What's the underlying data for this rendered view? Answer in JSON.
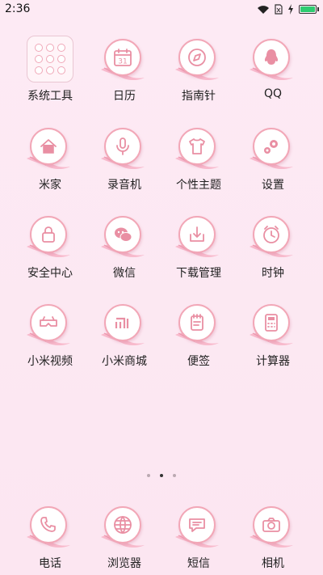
{
  "status_bar": {
    "time": "2:36",
    "battery_level": 1.0,
    "battery_color": "#2ecc71",
    "icons": [
      "wifi-icon",
      "sim-icon",
      "charging-icon",
      "battery-icon"
    ]
  },
  "apps": [
    {
      "label": "系统工具",
      "icon": "folder-icon"
    },
    {
      "label": "日历",
      "icon": "calendar-icon",
      "glyph_text": "31"
    },
    {
      "label": "指南针",
      "icon": "compass-icon"
    },
    {
      "label": "QQ",
      "icon": "qq-penguin-icon"
    },
    {
      "label": "米家",
      "icon": "home-icon"
    },
    {
      "label": "录音机",
      "icon": "microphone-icon"
    },
    {
      "label": "个性主题",
      "icon": "tshirt-icon"
    },
    {
      "label": "设置",
      "icon": "gear-icon"
    },
    {
      "label": "安全中心",
      "icon": "lock-icon"
    },
    {
      "label": "微信",
      "icon": "wechat-icon"
    },
    {
      "label": "下载管理",
      "icon": "download-icon"
    },
    {
      "label": "时钟",
      "icon": "clock-icon"
    },
    {
      "label": "小米视频",
      "icon": "video-glasses-icon"
    },
    {
      "label": "小米商城",
      "icon": "mi-store-icon",
      "glyph_text": "mi"
    },
    {
      "label": "便签",
      "icon": "notepad-icon"
    },
    {
      "label": "计算器",
      "icon": "calculator-icon"
    }
  ],
  "page_indicator": {
    "count": 3,
    "active": 2
  },
  "dock": [
    {
      "label": "电话",
      "icon": "phone-icon"
    },
    {
      "label": "浏览器",
      "icon": "browser-globe-icon"
    },
    {
      "label": "短信",
      "icon": "message-icon"
    },
    {
      "label": "相机",
      "icon": "camera-icon"
    }
  ],
  "theme": {
    "background": "#fde8f3",
    "accent": "#f2a7b7",
    "glyph_color": "#e98fa3"
  }
}
